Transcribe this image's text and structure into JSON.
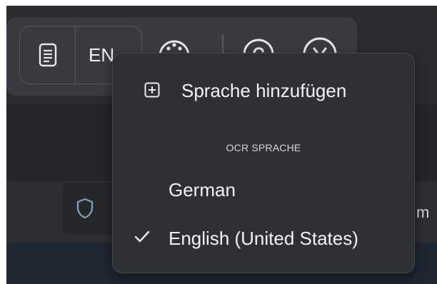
{
  "toolbar": {
    "language_code": "EN",
    "icons": [
      "document-icon",
      "palette-icon",
      "help-icon",
      "close-icon"
    ]
  },
  "background": {
    "partial_text": "m"
  },
  "menu": {
    "add_language_label": "Sprache hinzufügen",
    "section_title": "OCR SPRACHE",
    "languages": [
      {
        "label": "German",
        "selected": false
      },
      {
        "label": "English (United States)",
        "selected": true
      }
    ]
  },
  "colors": {
    "app_bg": "#2b2c30",
    "toolbar_bg": "#3a3b40",
    "menu_bg": "#2f3034",
    "text": "#f2f2f4",
    "accent_shield": "#7fa3c2"
  }
}
